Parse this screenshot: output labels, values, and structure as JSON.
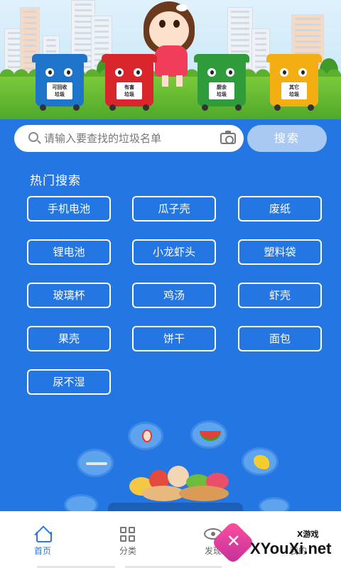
{
  "search": {
    "placeholder": "请输入要查找的垃圾名单",
    "button_label": "搜索"
  },
  "banner": {
    "bins": [
      {
        "label": "可回收\n垃圾",
        "color": "#1e74c9"
      },
      {
        "label": "有害\n垃圾",
        "color": "#d8262c"
      },
      {
        "label": "厨余\n垃圾",
        "color": "#2f9b3a"
      },
      {
        "label": "其它\n垃圾",
        "color": "#f2ae12"
      }
    ]
  },
  "hot": {
    "title": "热门搜索",
    "items": [
      "手机电池",
      "瓜子壳",
      "废纸",
      "锂电池",
      "小龙虾头",
      "塑料袋",
      "玻璃杯",
      "鸡汤",
      "虾壳",
      "果壳",
      "饼干",
      "面包",
      "尿不湿"
    ]
  },
  "tabs": [
    {
      "label": "首页",
      "icon": "home-icon",
      "active": true
    },
    {
      "label": "分类",
      "icon": "grid-icon",
      "active": false
    },
    {
      "label": "发现",
      "icon": "eye-icon",
      "active": false
    },
    {
      "label": "我的",
      "icon": "user-icon",
      "active": false
    }
  ],
  "watermark": {
    "small": "X游戏",
    "big": "XYouXi.net"
  },
  "colors": {
    "background": "#2477e2",
    "accent": "#2b7ae4",
    "search_button": "#a9c9f3"
  }
}
